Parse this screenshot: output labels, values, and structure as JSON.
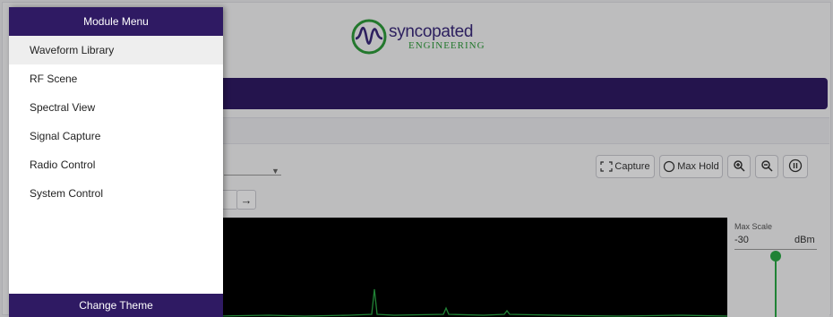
{
  "drawer": {
    "title": "Module Menu",
    "items": [
      {
        "label": "Waveform Library",
        "active": true
      },
      {
        "label": "RF Scene"
      },
      {
        "label": "Spectral View"
      },
      {
        "label": "Signal Capture"
      },
      {
        "label": "Radio Control"
      },
      {
        "label": "System Control"
      }
    ],
    "footer": "Change Theme"
  },
  "logo": {
    "main": "syncopated",
    "sub": "ENGINEERING"
  },
  "toolbar": {
    "capture_label": "Capture",
    "maxhold_label": "Max Hold",
    "zoom_in_icon": "zoom-in-icon",
    "zoom_out_icon": "zoom-out-icon",
    "pause_icon": "pause-icon"
  },
  "nav": {
    "next_label": "→"
  },
  "scale": {
    "title": "Max Scale",
    "value": "-30",
    "unit": "dBm"
  },
  "colors": {
    "brand_purple": "#2f1a63",
    "signal_green": "#2aa745"
  }
}
